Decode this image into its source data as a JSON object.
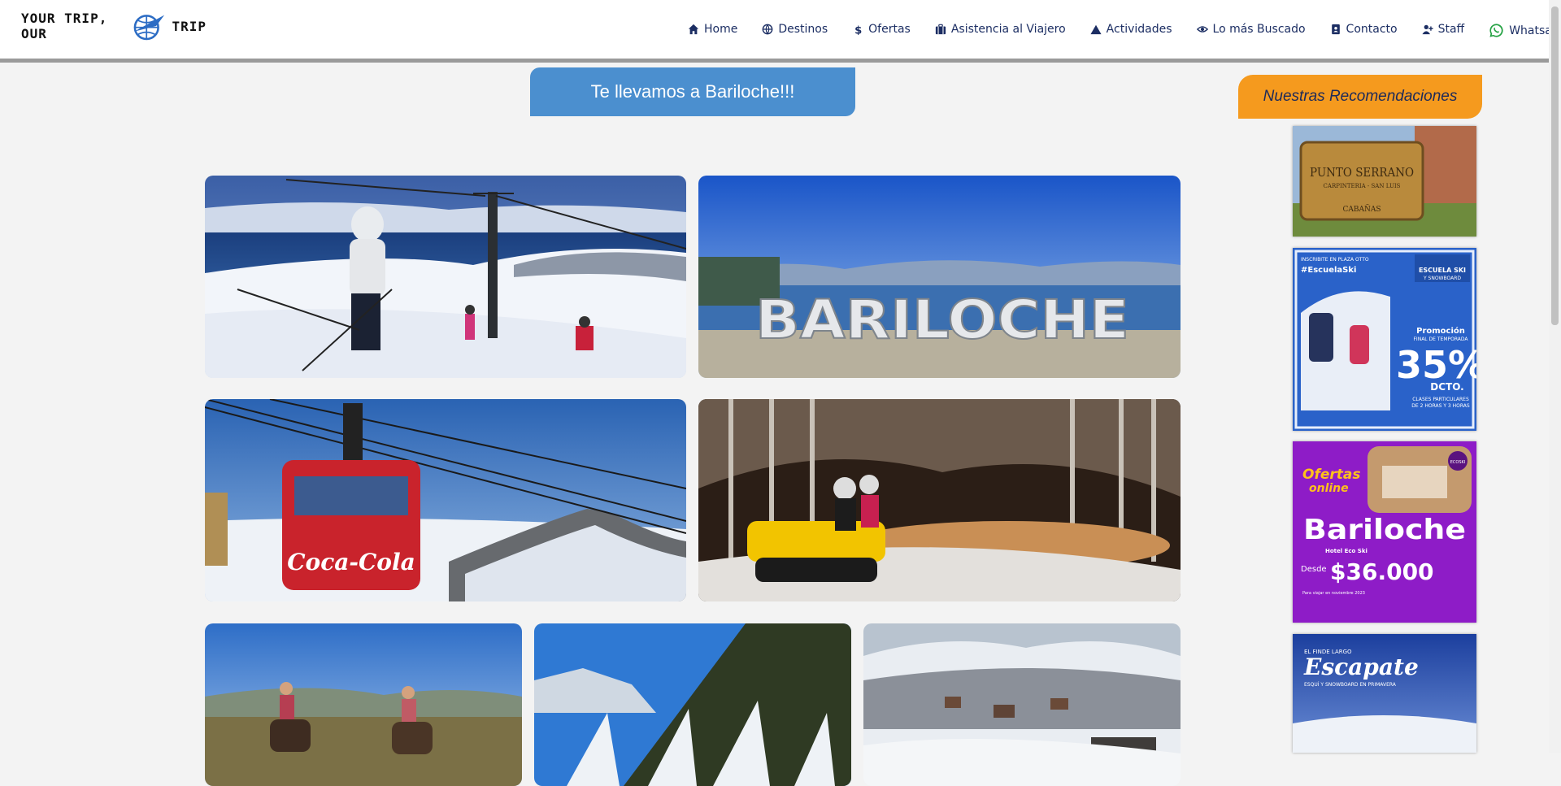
{
  "brand": {
    "left_text": "YOUR TRIP, OUR",
    "right_text": "TRIP"
  },
  "nav": [
    {
      "label": "Home",
      "icon": "home-icon"
    },
    {
      "label": "Destinos",
      "icon": "globe-icon"
    },
    {
      "label": "Ofertas",
      "icon": "dollar-icon"
    },
    {
      "label": "Asistencia al Viajero",
      "icon": "briefcase-icon"
    },
    {
      "label": "Actividades",
      "icon": "mountain-icon"
    },
    {
      "label": "Lo más Buscado",
      "icon": "eye-icon"
    },
    {
      "label": "Contacto",
      "icon": "address-book-icon"
    },
    {
      "label": "Staff",
      "icon": "user-plus-icon"
    },
    {
      "label": "Whatsapp",
      "icon": "whatsapp-icon"
    }
  ],
  "main": {
    "title": "Te llevamos a Bariloche!!!"
  },
  "gallery": {
    "photo2_sign": "BARILOCHE",
    "photo3_cabin_brand": "Coca-Cola"
  },
  "sidebar": {
    "title": "Nuestras Recomendaciones",
    "ads": {
      "a1": {
        "line1": "PUNTO SERRANO",
        "line2": "CARPINTERIA - SAN LUIS",
        "line3": "CABAÑAS"
      },
      "a2": {
        "top": "INSCRIBITE EN PLAZA OTTO",
        "hashtag": "#EscuelaSki",
        "badge1": "ESCUELA SKI",
        "badge2": "Y SNOWBOARD",
        "promo": "Promoción",
        "promo_sub": "FINAL DE TEMPORADA",
        "big": "35%",
        "dcto": "DCTO.",
        "desc1": "CLASES PARTICULARES",
        "desc2": "DE 2 HORAS Y 3 HORAS"
      },
      "a3": {
        "ofertas": "Ofertas",
        "online": "online",
        "brand": "ECOSKI",
        "city": "Bariloche",
        "hotel": "Hotel Eco Ski",
        "desde": "Desde",
        "price": "$36.000",
        "travel": "Para viajar en noviembre 2023"
      },
      "a4": {
        "line1": "EL FINDE LARGO",
        "title": "Escapate",
        "line2": "ESQUÍ Y SNOWBOARD EN PRIMAVERA"
      }
    }
  },
  "colors": {
    "nav_text": "#1c2e63",
    "title_bg": "#4b8fcf",
    "rec_bg": "#f59a1e",
    "whatsapp": "#25a244",
    "page_bg": "#f3f3f3"
  }
}
